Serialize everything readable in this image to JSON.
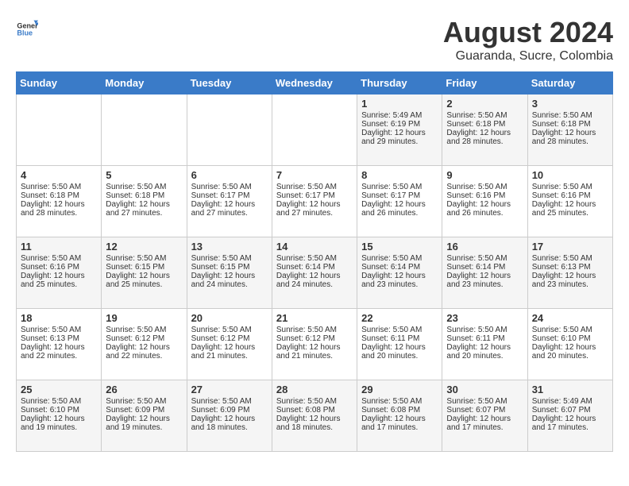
{
  "header": {
    "logo_general": "General",
    "logo_blue": "Blue",
    "month_title": "August 2024",
    "location": "Guaranda, Sucre, Colombia"
  },
  "weekdays": [
    "Sunday",
    "Monday",
    "Tuesday",
    "Wednesday",
    "Thursday",
    "Friday",
    "Saturday"
  ],
  "weeks": [
    [
      {
        "day": "",
        "text": ""
      },
      {
        "day": "",
        "text": ""
      },
      {
        "day": "",
        "text": ""
      },
      {
        "day": "",
        "text": ""
      },
      {
        "day": "1",
        "text": "Sunrise: 5:49 AM\nSunset: 6:19 PM\nDaylight: 12 hours\nand 29 minutes."
      },
      {
        "day": "2",
        "text": "Sunrise: 5:50 AM\nSunset: 6:18 PM\nDaylight: 12 hours\nand 28 minutes."
      },
      {
        "day": "3",
        "text": "Sunrise: 5:50 AM\nSunset: 6:18 PM\nDaylight: 12 hours\nand 28 minutes."
      }
    ],
    [
      {
        "day": "4",
        "text": "Sunrise: 5:50 AM\nSunset: 6:18 PM\nDaylight: 12 hours\nand 28 minutes."
      },
      {
        "day": "5",
        "text": "Sunrise: 5:50 AM\nSunset: 6:18 PM\nDaylight: 12 hours\nand 27 minutes."
      },
      {
        "day": "6",
        "text": "Sunrise: 5:50 AM\nSunset: 6:17 PM\nDaylight: 12 hours\nand 27 minutes."
      },
      {
        "day": "7",
        "text": "Sunrise: 5:50 AM\nSunset: 6:17 PM\nDaylight: 12 hours\nand 27 minutes."
      },
      {
        "day": "8",
        "text": "Sunrise: 5:50 AM\nSunset: 6:17 PM\nDaylight: 12 hours\nand 26 minutes."
      },
      {
        "day": "9",
        "text": "Sunrise: 5:50 AM\nSunset: 6:16 PM\nDaylight: 12 hours\nand 26 minutes."
      },
      {
        "day": "10",
        "text": "Sunrise: 5:50 AM\nSunset: 6:16 PM\nDaylight: 12 hours\nand 25 minutes."
      }
    ],
    [
      {
        "day": "11",
        "text": "Sunrise: 5:50 AM\nSunset: 6:16 PM\nDaylight: 12 hours\nand 25 minutes."
      },
      {
        "day": "12",
        "text": "Sunrise: 5:50 AM\nSunset: 6:15 PM\nDaylight: 12 hours\nand 25 minutes."
      },
      {
        "day": "13",
        "text": "Sunrise: 5:50 AM\nSunset: 6:15 PM\nDaylight: 12 hours\nand 24 minutes."
      },
      {
        "day": "14",
        "text": "Sunrise: 5:50 AM\nSunset: 6:14 PM\nDaylight: 12 hours\nand 24 minutes."
      },
      {
        "day": "15",
        "text": "Sunrise: 5:50 AM\nSunset: 6:14 PM\nDaylight: 12 hours\nand 23 minutes."
      },
      {
        "day": "16",
        "text": "Sunrise: 5:50 AM\nSunset: 6:14 PM\nDaylight: 12 hours\nand 23 minutes."
      },
      {
        "day": "17",
        "text": "Sunrise: 5:50 AM\nSunset: 6:13 PM\nDaylight: 12 hours\nand 23 minutes."
      }
    ],
    [
      {
        "day": "18",
        "text": "Sunrise: 5:50 AM\nSunset: 6:13 PM\nDaylight: 12 hours\nand 22 minutes."
      },
      {
        "day": "19",
        "text": "Sunrise: 5:50 AM\nSunset: 6:12 PM\nDaylight: 12 hours\nand 22 minutes."
      },
      {
        "day": "20",
        "text": "Sunrise: 5:50 AM\nSunset: 6:12 PM\nDaylight: 12 hours\nand 21 minutes."
      },
      {
        "day": "21",
        "text": "Sunrise: 5:50 AM\nSunset: 6:12 PM\nDaylight: 12 hours\nand 21 minutes."
      },
      {
        "day": "22",
        "text": "Sunrise: 5:50 AM\nSunset: 6:11 PM\nDaylight: 12 hours\nand 20 minutes."
      },
      {
        "day": "23",
        "text": "Sunrise: 5:50 AM\nSunset: 6:11 PM\nDaylight: 12 hours\nand 20 minutes."
      },
      {
        "day": "24",
        "text": "Sunrise: 5:50 AM\nSunset: 6:10 PM\nDaylight: 12 hours\nand 20 minutes."
      }
    ],
    [
      {
        "day": "25",
        "text": "Sunrise: 5:50 AM\nSunset: 6:10 PM\nDaylight: 12 hours\nand 19 minutes."
      },
      {
        "day": "26",
        "text": "Sunrise: 5:50 AM\nSunset: 6:09 PM\nDaylight: 12 hours\nand 19 minutes."
      },
      {
        "day": "27",
        "text": "Sunrise: 5:50 AM\nSunset: 6:09 PM\nDaylight: 12 hours\nand 18 minutes."
      },
      {
        "day": "28",
        "text": "Sunrise: 5:50 AM\nSunset: 6:08 PM\nDaylight: 12 hours\nand 18 minutes."
      },
      {
        "day": "29",
        "text": "Sunrise: 5:50 AM\nSunset: 6:08 PM\nDaylight: 12 hours\nand 17 minutes."
      },
      {
        "day": "30",
        "text": "Sunrise: 5:50 AM\nSunset: 6:07 PM\nDaylight: 12 hours\nand 17 minutes."
      },
      {
        "day": "31",
        "text": "Sunrise: 5:49 AM\nSunset: 6:07 PM\nDaylight: 12 hours\nand 17 minutes."
      }
    ]
  ]
}
